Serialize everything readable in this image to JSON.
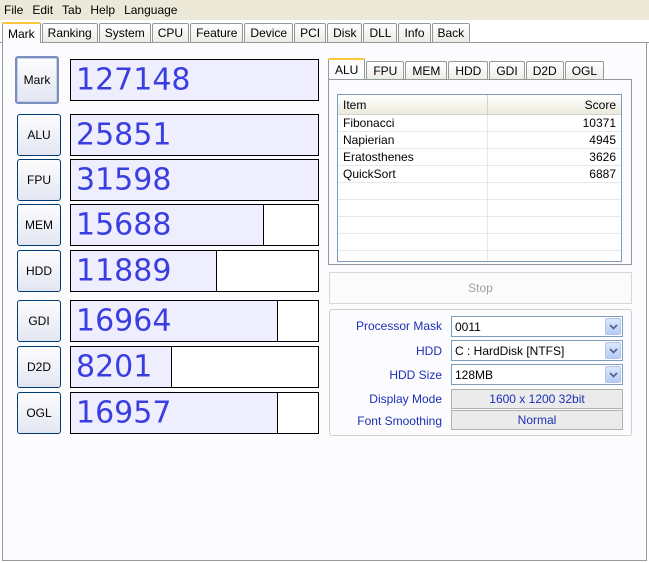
{
  "menu": [
    {
      "label": "File"
    },
    {
      "label": "Edit"
    },
    {
      "label": "Tab"
    },
    {
      "label": "Help"
    },
    {
      "label": "Language"
    }
  ],
  "tabs": [
    {
      "label": "Mark"
    },
    {
      "label": "Ranking"
    },
    {
      "label": "System"
    },
    {
      "label": "CPU"
    },
    {
      "label": "Feature"
    },
    {
      "label": "Device"
    },
    {
      "label": "PCI"
    },
    {
      "label": "Disk"
    },
    {
      "label": "DLL"
    },
    {
      "label": "Info"
    },
    {
      "label": "Back"
    }
  ],
  "benchmarks": {
    "mark": {
      "label": "Mark",
      "value": "127148",
      "fill": 1.0
    },
    "alu": {
      "label": "ALU",
      "value": "25851",
      "fill": 1.0
    },
    "fpu": {
      "label": "FPU",
      "value": "31598",
      "fill": 1.0
    },
    "mem": {
      "label": "MEM",
      "value": "15688",
      "fill": 0.78
    },
    "hdd": {
      "label": "HDD",
      "value": "11889",
      "fill": 0.59
    },
    "gdi": {
      "label": "GDI",
      "value": "16964",
      "fill": 0.84
    },
    "d2d": {
      "label": "D2D",
      "value": "8201",
      "fill": 0.41
    },
    "ogl": {
      "label": "OGL",
      "value": "16957",
      "fill": 0.84
    }
  },
  "subtabs": [
    {
      "label": "ALU"
    },
    {
      "label": "FPU"
    },
    {
      "label": "MEM"
    },
    {
      "label": "HDD"
    },
    {
      "label": "GDI"
    },
    {
      "label": "D2D"
    },
    {
      "label": "OGL"
    }
  ],
  "results": {
    "header_item": "Item",
    "header_score": "Score",
    "rows": [
      {
        "item": "Fibonacci",
        "score": "10371"
      },
      {
        "item": "Napierian",
        "score": "4945"
      },
      {
        "item": "Eratosthenes",
        "score": "3626"
      },
      {
        "item": "QuickSort",
        "score": "6887"
      }
    ]
  },
  "stop_label": "Stop",
  "options": {
    "processor_mask_label": "Processor Mask",
    "processor_mask_value": "0011",
    "hdd_label": "HDD",
    "hdd_value": "C : HardDisk [NTFS]",
    "hdd_size_label": "HDD Size",
    "hdd_size_value": "128MB",
    "display_mode_label": "Display Mode",
    "display_mode_value": "1600 x 1200 32bit",
    "font_smoothing_label": "Font Smoothing",
    "font_smoothing_value": "Normal"
  },
  "colors": {
    "score_text": "#3a3ee0",
    "bar_fill": "#eeeeff",
    "option_label": "#1c2fb8",
    "active_tab_accent": "#ffc83c"
  }
}
